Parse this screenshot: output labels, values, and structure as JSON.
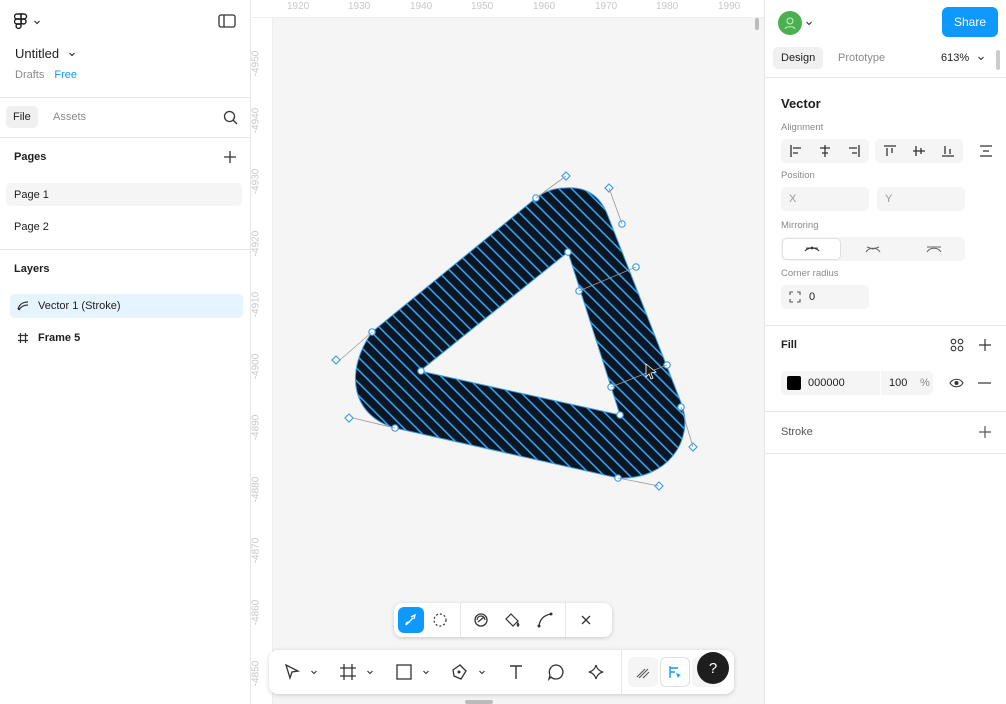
{
  "file": {
    "name": "Untitled",
    "location": "Drafts",
    "plan": "Free"
  },
  "left_tabs": {
    "file": "File",
    "assets": "Assets"
  },
  "pages": {
    "title": "Pages",
    "items": [
      "Page 1",
      "Page 2"
    ]
  },
  "layers": {
    "title": "Layers",
    "items": [
      "Vector 1 (Stroke)",
      "Frame 5"
    ]
  },
  "ruler": {
    "top": [
      "1920",
      "1930",
      "1940",
      "1950",
      "1960",
      "1970",
      "1980",
      "1990"
    ],
    "left": [
      "-4950",
      "-4940",
      "-4930",
      "-4920",
      "-4910",
      "-4900",
      "-4890",
      "-4880",
      "-4870",
      "-4860",
      "-4850"
    ]
  },
  "header": {
    "share": "Share",
    "tab_design": "Design",
    "tab_prototype": "Prototype",
    "zoom": "613%"
  },
  "design": {
    "title": "Vector",
    "alignment_label": "Alignment",
    "position_label": "Position",
    "x_placeholder": "X",
    "y_placeholder": "Y",
    "mirroring_label": "Mirroring",
    "corner_radius_label": "Corner radius",
    "corner_radius": "0"
  },
  "fill": {
    "title": "Fill",
    "hex": "000000",
    "opacity": "100",
    "unit": "%",
    "color": "#000000"
  },
  "stroke": {
    "title": "Stroke"
  },
  "help": "?",
  "colors": {
    "accent": "#0d99ff",
    "selection": "#e5f4ff",
    "avatar": "#4caf50"
  }
}
